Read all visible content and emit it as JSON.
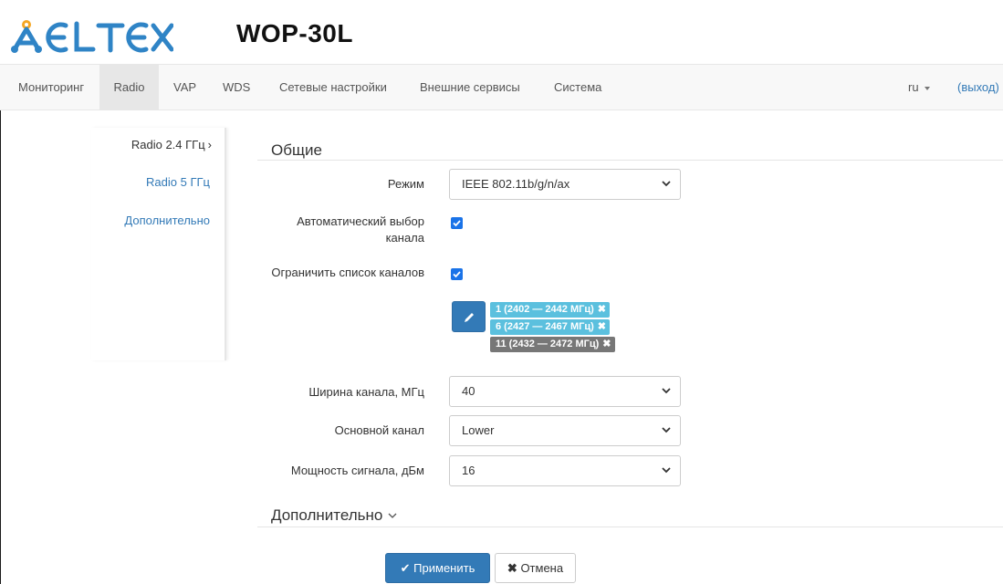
{
  "header": {
    "logo_text": "ELTEX",
    "model": "WOP-30L"
  },
  "nav": {
    "items": [
      "Мониторинг",
      "Radio",
      "VAP",
      "WDS",
      "Сетевые настройки",
      "Внешние сервисы",
      "Система"
    ],
    "active": "Radio",
    "language": "ru",
    "logout": "(выход)"
  },
  "sidebar": {
    "items": [
      {
        "label": "Radio 2.4 ГГц"
      },
      {
        "label": "Radio 5 ГГц"
      },
      {
        "label": "Дополнительно"
      }
    ],
    "current_marker": "›"
  },
  "form": {
    "section_title": "Общие",
    "mode": {
      "label": "Режим",
      "value": "IEEE 802.11b/g/n/ax"
    },
    "auto_channel": {
      "label_line1": "Автоматический выбор",
      "label_line2": "канала",
      "checked": true
    },
    "limit_channels": {
      "label": "Ограничить список каналов",
      "checked": true
    },
    "channel_tags": [
      {
        "text": "1 (2402 — 2442 МГц)",
        "color": "#5bc0de"
      },
      {
        "text": "6 (2427 — 2467 МГц)",
        "color": "#5bc0de"
      },
      {
        "text": "11 (2432 — 2472 МГц)",
        "color": "#777777"
      }
    ],
    "channel_width": {
      "label": "Ширина канала, МГц",
      "value": "40"
    },
    "primary_channel": {
      "label": "Основной канал",
      "value": "Lower"
    },
    "tx_power": {
      "label": "Мощность сигнала, дБм",
      "value": "16"
    },
    "advanced_title": "Дополнительно"
  },
  "buttons": {
    "apply": "Применить",
    "cancel": "Отмена"
  },
  "colors": {
    "brand": "#2f84c6",
    "logo_accent": "#f5a623",
    "primary": "#337ab7",
    "checkbox": "#1a73e8"
  }
}
